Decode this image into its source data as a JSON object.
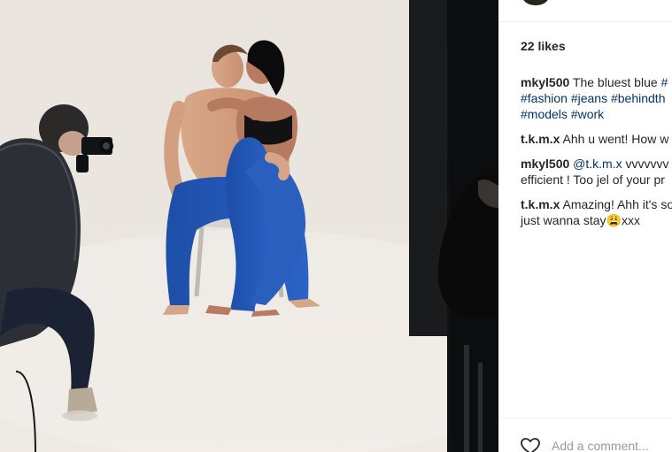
{
  "post": {
    "likes": "22 likes",
    "caption": {
      "user": "mkyl500",
      "text_line1": "The bluest blue",
      "hashtag_cut": "#",
      "tags_line2": [
        "#fashion",
        "#jeans",
        "#behindth"
      ],
      "tags_line3": [
        "#models",
        "#work"
      ]
    },
    "comments": [
      {
        "user": "t.k.m.x",
        "text": "Ahh u went! How w"
      },
      {
        "user": "mkyl500",
        "mention": "@t.k.m.x",
        "text_line1": "vvvvvvv",
        "text_line2": "efficient ! Too jel of your pr"
      },
      {
        "user": "t.k.m.x",
        "text_line1": "Amazing! Ahh it's so",
        "text_line2": "just wanna stay",
        "emoji": "😩",
        "text_after_emoji": "xxx"
      }
    ],
    "add_comment": {
      "placeholder": "Add a comment..."
    }
  },
  "icons": {
    "like": "heart-outline-icon"
  },
  "colors": {
    "username": "#262626",
    "hashtag": "#003569",
    "placeholder": "#999999"
  }
}
